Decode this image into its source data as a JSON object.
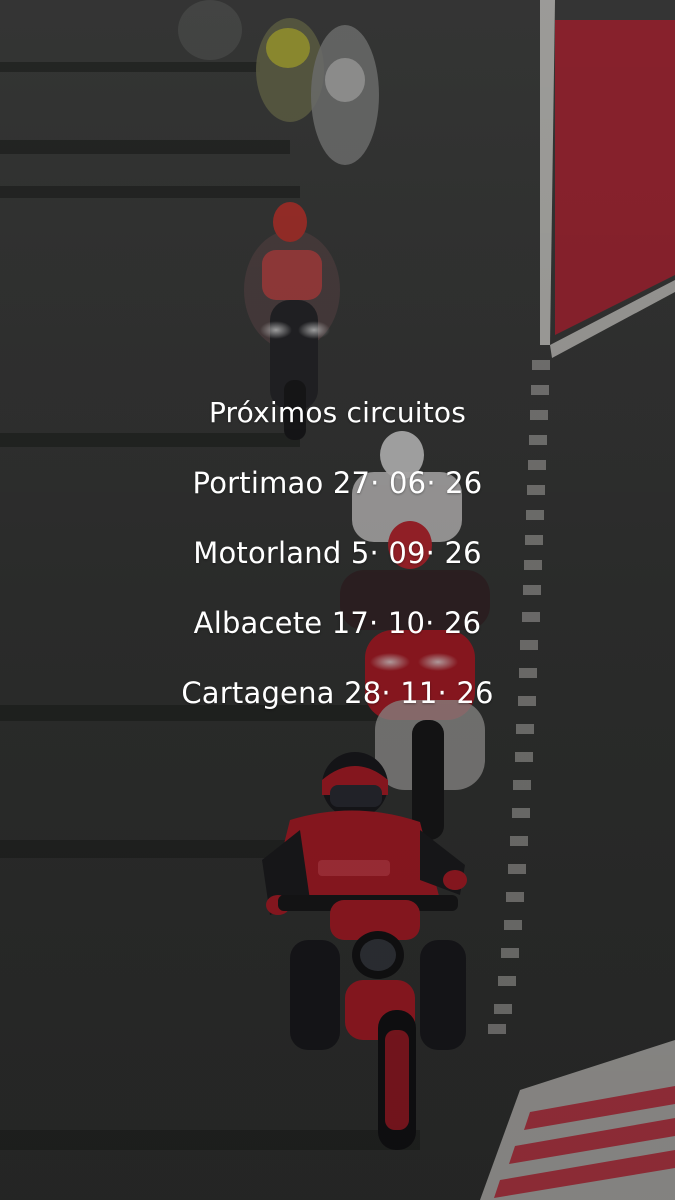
{
  "story": {
    "heading": "Próximos circuitos",
    "events": [
      {
        "label": "Portimao 27· 06· 26"
      },
      {
        "label": "Motorland 5· 09· 26"
      },
      {
        "label": "Albacete 17· 10· 26"
      },
      {
        "label": "Cartagena 28· 11· 26"
      }
    ]
  },
  "colors": {
    "asphalt": "#3a3b3a",
    "kerb_red": "#c8283a",
    "line_white": "#e8e6e2",
    "rider_red": "#b81f2a",
    "text": "#ffffff"
  },
  "background": {
    "subject": "motorcycles-on-race-track-photo"
  }
}
